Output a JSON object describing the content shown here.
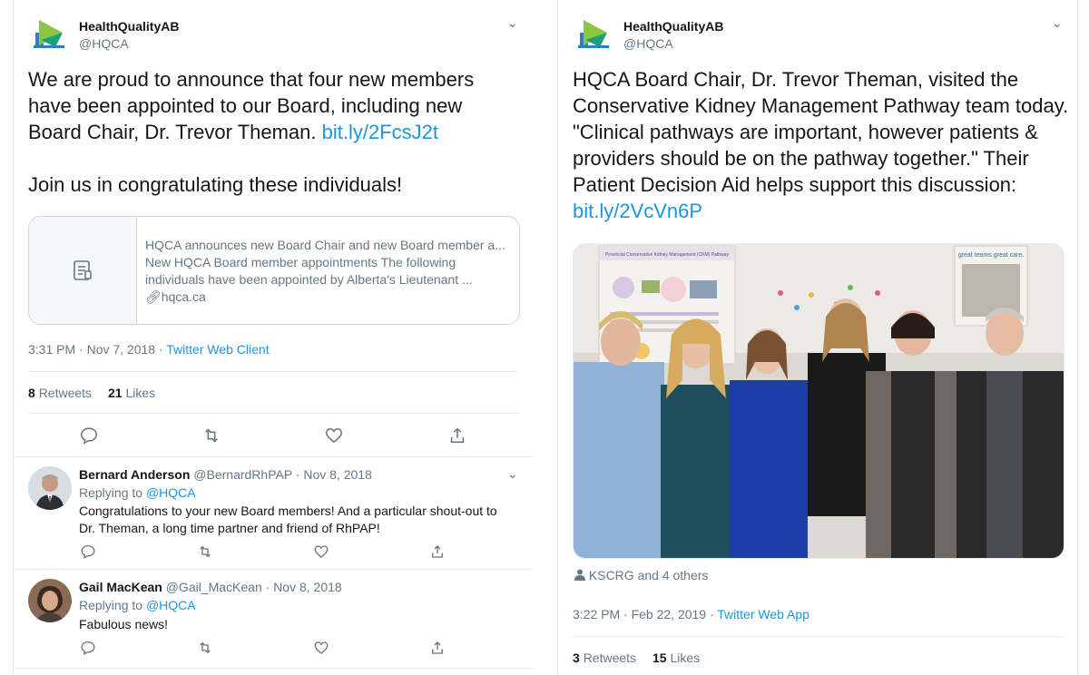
{
  "left": {
    "author_name": "HealthQualityAB",
    "author_handle": "@HQCA",
    "text_lines": [
      "We are proud to announce that four new members",
      "have been appointed to our Board, including new"
    ],
    "text_line3": "Board Chair, Dr. Trevor Theman. ",
    "link": "bit.ly/2FcsJ2t",
    "text_line4": "Join us in congratulating these individuals!",
    "card": {
      "title": "HQCA announces new Board Chair and new Board member a...",
      "desc_line1": "New HQCA Board member appointments The following",
      "desc_line2": "individuals have been appointed by Alberta's Lieutenant ...",
      "domain": "hqca.ca"
    },
    "timestamp": "3:31 PM · Nov 7, 2018 · ",
    "source": "Twitter Web Client",
    "retweets": "8",
    "retweets_label": "Retweets",
    "likes": "21",
    "likes_label": "Likes",
    "replies": [
      {
        "name": "Bernard Anderson",
        "handle": "@BernardRhPAP · Nov 8, 2018",
        "replying_prefix": "Replying to ",
        "replying_to": "@HQCA",
        "text_line1": "Congratulations to your new Board members! And a particular shout-out to",
        "text_line2": "Dr. Theman, a long time partner and friend of RhPAP!"
      },
      {
        "name": "Gail MacKean",
        "handle": "@Gail_MacKean · Nov 8, 2018",
        "replying_prefix": "Replying to ",
        "replying_to": "@HQCA",
        "text_line1": "Fabulous news!"
      }
    ]
  },
  "right": {
    "author_name": "HealthQualityAB",
    "author_handle": "@HQCA",
    "text_lines": [
      "HQCA Board Chair, Dr. Trevor Theman, visited the",
      "Conservative Kidney Management Pathway team today.",
      "\"Clinical pathways are important, however patients &",
      "providers should be on the pathway together.\" Their",
      "Patient Decision Aid helps support this discussion:"
    ],
    "link": "bit.ly/2VcVn6P",
    "poster_title": "Provincial Conservative Kidney Management (CKM) Pathway",
    "poster_right": "great teams great care.",
    "tagged": "KSCRG and 4 others",
    "timestamp": "3:22 PM · Feb 22, 2019 · ",
    "source": "Twitter Web App",
    "retweets": "3",
    "retweets_label": "Retweets",
    "likes": "15",
    "likes_label": "Likes"
  },
  "colors": {
    "link": "#1b95e0",
    "secondary": "#657786",
    "divider": "#e6ecf0"
  }
}
